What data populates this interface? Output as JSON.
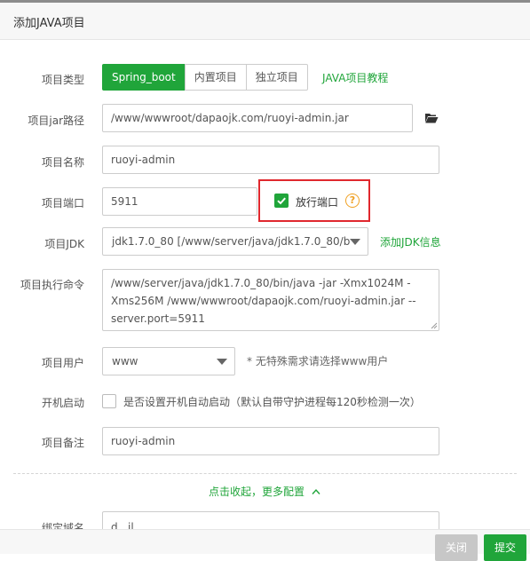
{
  "dialog": {
    "title": "添加JAVA项目"
  },
  "form": {
    "project_type": {
      "label": "项目类型",
      "options": [
        "Spring_boot",
        "内置项目",
        "独立项目"
      ],
      "active": "Spring_boot",
      "tutorial_link": "JAVA项目教程"
    },
    "jar_path": {
      "label": "项目jar路径",
      "value": "/www/wwwroot/dapaojk.com/ruoyi-admin.jar",
      "icon": "folder-open-icon"
    },
    "name": {
      "label": "项目名称",
      "value": "ruoyi-admin"
    },
    "port": {
      "label": "项目端口",
      "value": "5911",
      "release_port": {
        "label": "放行端口",
        "checked": true,
        "help": "?"
      }
    },
    "jdk": {
      "label": "项目JDK",
      "value": "jdk1.7.0_80 [/www/server/java/jdk1.7.0_80/b",
      "add_link": "添加JDK信息"
    },
    "command": {
      "label": "项目执行命令",
      "value": "/www/server/java/jdk1.7.0_80/bin/java -jar -Xmx1024M -Xms256M  /www/wwwroot/dapaojk.com/ruoyi-admin.jar --server.port=5911"
    },
    "user": {
      "label": "项目用户",
      "value": "www",
      "note": "* 无特殊需求请选择www用户"
    },
    "autostart": {
      "label": "开机启动",
      "checked": false,
      "text": "是否设置开机自动启动（默认自带守护进程每120秒检测一次）"
    },
    "remark": {
      "label": "项目备注",
      "value": "ruoyi-admin"
    },
    "collapse_link": "点击收起，更多配置",
    "domain": {
      "label": "绑定域名",
      "value": "d...il..."
    }
  },
  "footer": {
    "close": "关闭",
    "submit": "提交"
  },
  "colors": {
    "primary": "#20a53a",
    "highlight": "#e0282e",
    "help": "#f0a022"
  }
}
